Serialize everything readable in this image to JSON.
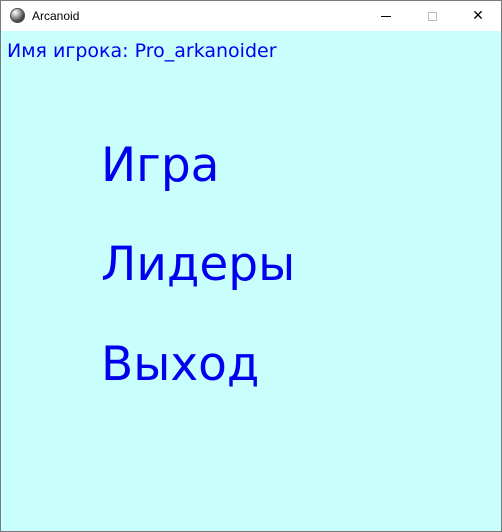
{
  "window": {
    "title": "Arcanoid",
    "app_icon": "ball-icon",
    "buttons": {
      "minimize_icon": "minimize-icon",
      "maximize_icon": "maximize-icon",
      "close_icon": "close-icon",
      "close_glyph": "✕"
    }
  },
  "player": {
    "line": "Имя игрока: Pro_arkanoider"
  },
  "menu": {
    "items": [
      {
        "label": "Игра"
      },
      {
        "label": "Лидеры"
      },
      {
        "label": "Выход"
      }
    ]
  },
  "colors": {
    "background": "#c8fffc",
    "text": "#0000ee",
    "titlebar": "#ffffff"
  }
}
